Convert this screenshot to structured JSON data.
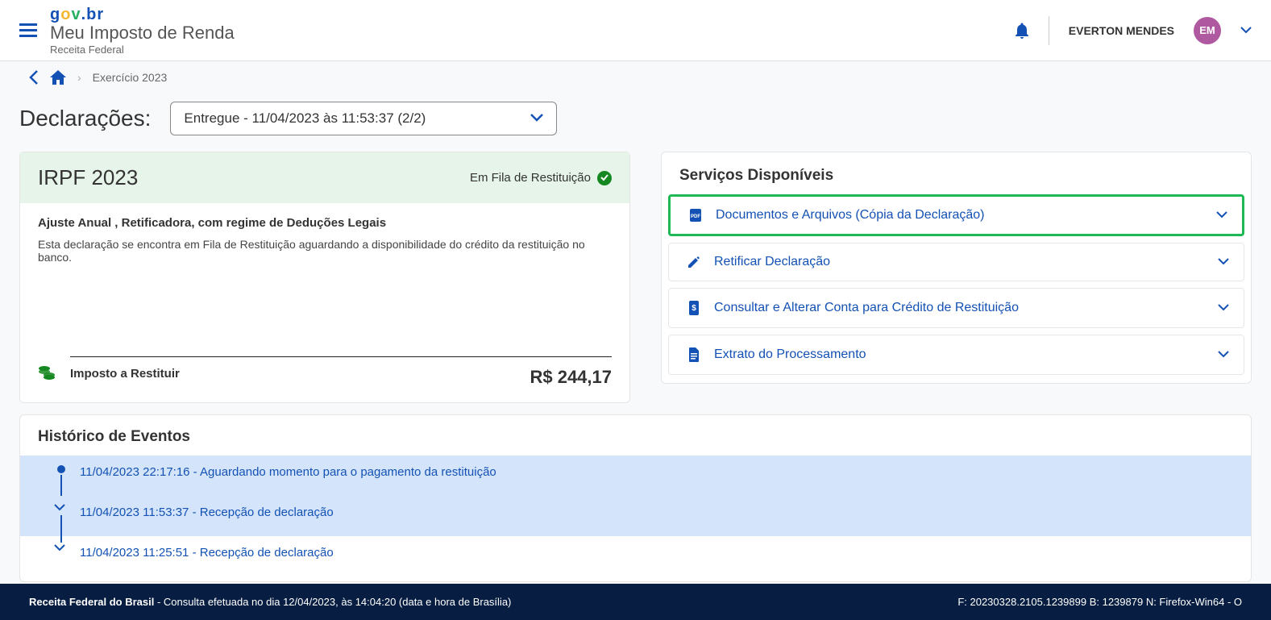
{
  "header": {
    "app_title": "Meu Imposto de Renda",
    "app_subtitle": "Receita Federal",
    "user_name": "EVERTON MENDES",
    "user_initials": "EM"
  },
  "breadcrumb": {
    "current": "Exercício 2023"
  },
  "declarations": {
    "label": "Declarações:",
    "selected": "Entregue - 11/04/2023 às 11:53:37 (2/2)"
  },
  "irpf": {
    "title": "IRPF 2023",
    "status": "Em Fila de Restituição",
    "subtitle": "Ajuste Anual , Retificadora, com regime de Deduções Legais",
    "description": "Esta declaração se encontra em Fila de Restituição aguardando a disponibilidade do crédito da restituição no banco.",
    "restituir_label": "Imposto a Restituir",
    "restituir_value": "R$ 244,17"
  },
  "services": {
    "title": "Serviços Disponíveis",
    "items": [
      {
        "label": "Documentos e Arquivos (Cópia da Declaração)",
        "icon": "pdf"
      },
      {
        "label": "Retificar Declaração",
        "icon": "edit"
      },
      {
        "label": "Consultar e Alterar Conta para Crédito de Restituição",
        "icon": "dollar"
      },
      {
        "label": "Extrato do Processamento",
        "icon": "doc"
      }
    ]
  },
  "history": {
    "title": "Histórico de Eventos",
    "events": [
      {
        "text": "11/04/2023 22:17:16 - Aguardando momento para o pagamento da restituição",
        "marker": "dot",
        "highlighted": true
      },
      {
        "text": "11/04/2023 11:53:37 - Recepção de declaração",
        "marker": "chev",
        "highlighted": true
      },
      {
        "text": "11/04/2023 11:25:51 - Recepção de declaração",
        "marker": "chev",
        "highlighted": false
      }
    ]
  },
  "footer": {
    "org": "Receita Federal do Brasil",
    "query_info": " - Consulta efetuada no dia 12/04/2023, às 14:04:20 (data e hora de Brasília)",
    "meta": "F: 20230328.2105.1239899 B: 1239879 N: Firefox-Win64 - O"
  }
}
